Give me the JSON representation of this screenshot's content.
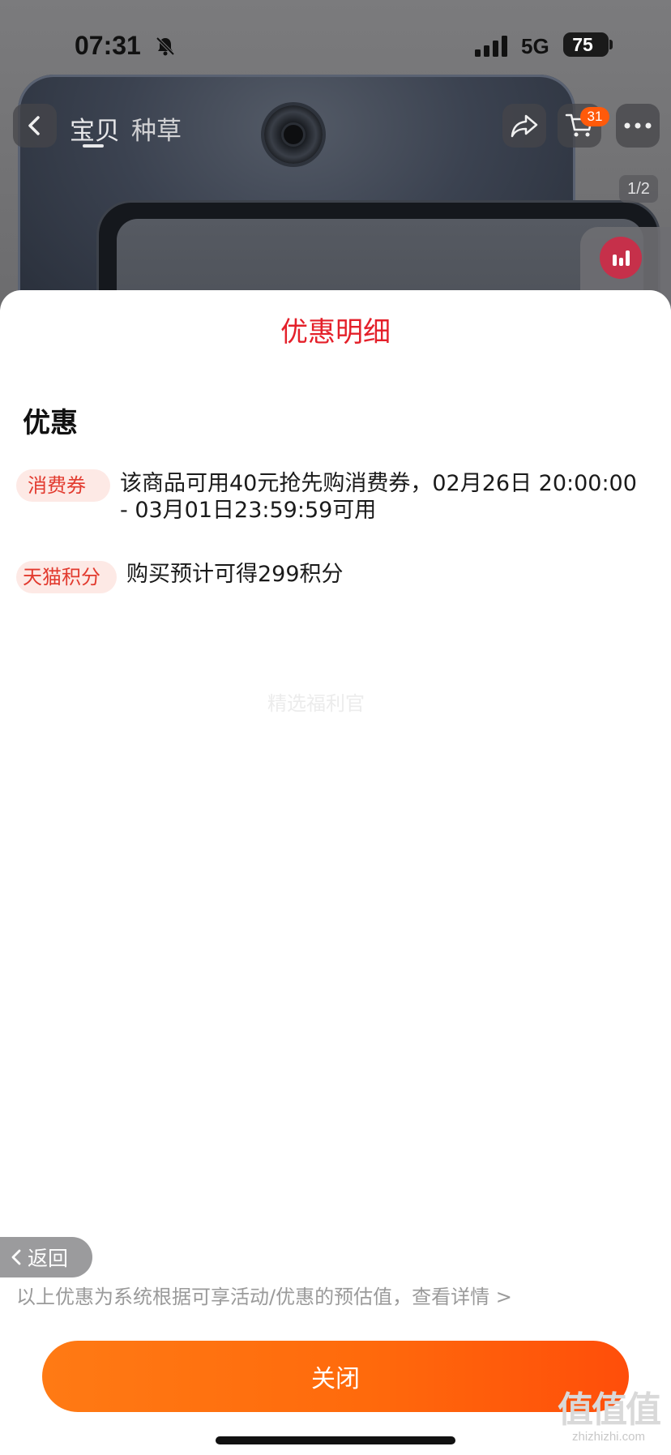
{
  "status_bar": {
    "time": "07:31",
    "network": "5G",
    "battery": "75"
  },
  "nav": {
    "tabs": [
      {
        "label": "宝贝",
        "active": true
      },
      {
        "label": "种草",
        "active": false
      }
    ],
    "cart_badge": "31",
    "image_counter": "1/2"
  },
  "sheet": {
    "title": "优惠明细",
    "section_heading": "优惠",
    "promos": [
      {
        "tag": "消费券",
        "text": "该商品可用40元抢先购消费券，02月26日 20:00:00 - 03月01日23:59:59可用"
      },
      {
        "tag": "天猫积分",
        "text": "购买预计可得299积分"
      }
    ],
    "watermark": "精选福利官",
    "disclaimer": "以上优惠为系统根据可享活动/优惠的预估值，查看详情 >",
    "close_label": "关闭"
  },
  "back_pill": {
    "label": "返回"
  },
  "brand_watermark": {
    "mark": "值值值",
    "domain": "zhizhizhi.com"
  },
  "colors": {
    "accent_red": "#e4202a",
    "tag_bg": "#fde9e5",
    "close_gradient_start": "#ff7a14",
    "close_gradient_end": "#ff4e0a"
  }
}
